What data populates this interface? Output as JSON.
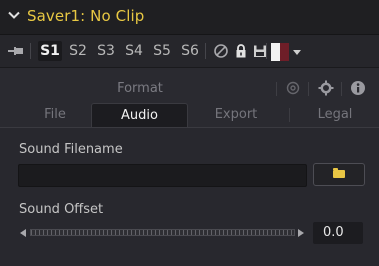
{
  "header": {
    "title": "Saver1: No Clip",
    "title_color": "#e8c843",
    "chevron_icon": "chevron-down-icon"
  },
  "toolbar": {
    "pin_icon": "pin-icon",
    "slots": [
      "S1",
      "S2",
      "S3",
      "S4",
      "S5",
      "S6"
    ],
    "active_slot": "S1",
    "icons": [
      "disable-icon",
      "lock-icon",
      "save-icon"
    ],
    "swatch_colors": [
      "#f2f2f2",
      "#6e1e28"
    ]
  },
  "tabs": {
    "top_row": [
      "Format"
    ],
    "top_icons": [
      "node-graph-icon",
      "settings-gear-icon",
      "info-icon"
    ],
    "bottom_row": [
      "File",
      "Audio",
      "Export",
      "Legal"
    ],
    "active_tab": "Audio"
  },
  "audio": {
    "sound_filename_label": "Sound Filename",
    "sound_filename_value": "",
    "browse_icon": "folder-icon",
    "sound_offset_label": "Sound Offset",
    "sound_offset_value": "0.0"
  }
}
